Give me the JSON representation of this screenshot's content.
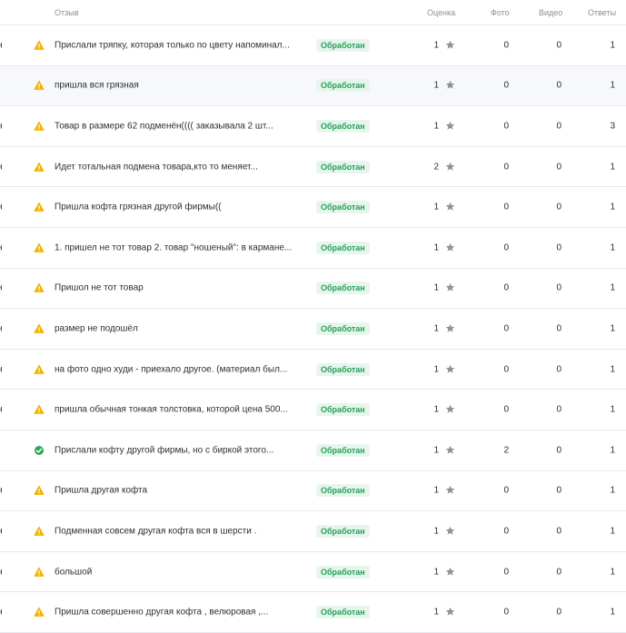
{
  "headers": {
    "review": "Отзыв",
    "rating": "Оценка",
    "photo": "Фото",
    "video": "Видео",
    "answers": "Ответы"
  },
  "colors": {
    "warning": "#f4b400",
    "success": "#2ca85a",
    "badge_bg": "#e7f6ec",
    "badge_text": "#26a05a",
    "star": "#8d939c"
  },
  "rows": [
    {
      "left": "н",
      "icon": "warning-icon",
      "text": "Прислали тряпку, которая только по цвету напоминал...",
      "status": "Обработан",
      "rating": "1",
      "photo": "0",
      "video": "0",
      "answers": "1"
    },
    {
      "left": "",
      "icon": "warning-icon",
      "text": "пришла вся грязная",
      "status": "Обработан",
      "rating": "1",
      "photo": "0",
      "video": "0",
      "answers": "1"
    },
    {
      "left": "н",
      "icon": "warning-icon",
      "text": "Товар в размере 62 подменён(((( заказывала 2 шт...",
      "status": "Обработан",
      "rating": "1",
      "photo": "0",
      "video": "0",
      "answers": "3"
    },
    {
      "left": "н",
      "icon": "warning-icon",
      "text": "Идет тотальная подмена товара,кто то меняет...",
      "status": "Обработан",
      "rating": "2",
      "photo": "0",
      "video": "0",
      "answers": "1"
    },
    {
      "left": "н",
      "icon": "warning-icon",
      "text": "Пришла кофта грязная другой фирмы((",
      "status": "Обработан",
      "rating": "1",
      "photo": "0",
      "video": "0",
      "answers": "1"
    },
    {
      "left": "н",
      "icon": "warning-icon",
      "text": "1. пришел не тот товар 2. товар \"ношеный\": в кармане...",
      "status": "Обработан",
      "rating": "1",
      "photo": "0",
      "video": "0",
      "answers": "1"
    },
    {
      "left": "н",
      "icon": "warning-icon",
      "text": "Пришол не тот товар",
      "status": "Обработан",
      "rating": "1",
      "photo": "0",
      "video": "0",
      "answers": "1"
    },
    {
      "left": "н",
      "icon": "warning-icon",
      "text": "размер не подошёл",
      "status": "Обработан",
      "rating": "1",
      "photo": "0",
      "video": "0",
      "answers": "1"
    },
    {
      "left": "н",
      "icon": "warning-icon",
      "text": "на фото одно худи - приехало другое. (материал был...",
      "status": "Обработан",
      "rating": "1",
      "photo": "0",
      "video": "0",
      "answers": "1"
    },
    {
      "left": "н",
      "icon": "warning-icon",
      "text": "пришла обычная тонкая толстовка, которой цена 500...",
      "status": "Обработан",
      "rating": "1",
      "photo": "0",
      "video": "0",
      "answers": "1"
    },
    {
      "left": "",
      "icon": "check-icon",
      "text": "Прислали кофту другой фирмы, но с биркой этого...",
      "status": "Обработан",
      "rating": "1",
      "photo": "2",
      "video": "0",
      "answers": "1"
    },
    {
      "left": "н",
      "icon": "warning-icon",
      "text": "Пришла другая кофта",
      "status": "Обработан",
      "rating": "1",
      "photo": "0",
      "video": "0",
      "answers": "1"
    },
    {
      "left": "н",
      "icon": "warning-icon",
      "text": "Подменная совсем другая кофта вся в шерсти .",
      "status": "Обработан",
      "rating": "1",
      "photo": "0",
      "video": "0",
      "answers": "1"
    },
    {
      "left": "н",
      "icon": "warning-icon",
      "text": "большой",
      "status": "Обработан",
      "rating": "1",
      "photo": "0",
      "video": "0",
      "answers": "1"
    },
    {
      "left": "н",
      "icon": "warning-icon",
      "text": "Пришла совершенно другая кофта , велюровая ,...",
      "status": "Обработан",
      "rating": "1",
      "photo": "0",
      "video": "0",
      "answers": "1"
    }
  ]
}
